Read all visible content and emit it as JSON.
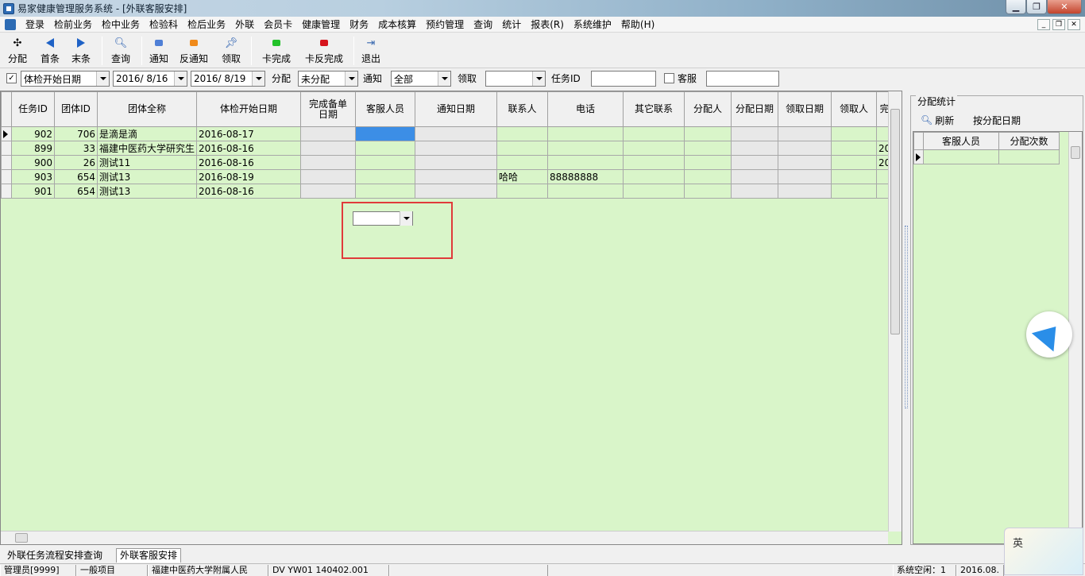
{
  "window": {
    "title": "易家健康管理服务系统 - [外联客服安排]",
    "controls": [
      "minimize",
      "restore",
      "close"
    ]
  },
  "menu": [
    "登录",
    "检前业务",
    "检中业务",
    "检验科",
    "检后业务",
    "外联",
    "会员卡",
    "健康管理",
    "财务",
    "成本核算",
    "预约管理",
    "查询",
    "统计",
    "报表(R)",
    "系统维护",
    "帮助(H)"
  ],
  "toolbar": {
    "assign": "分配",
    "first": "首条",
    "last": "末条",
    "query": "查询",
    "notify": "通知",
    "unnotify": "反通知",
    "receive": "领取",
    "card_complete": "卡完成",
    "card_uncomplete": "卡反完成",
    "exit": "退出"
  },
  "filters": {
    "date_type": "体检开始日期",
    "date_from": "2016/ 8/16",
    "date_to": "2016/ 8/19",
    "assign_label": "分配",
    "assign_value": "未分配",
    "notify_label": "通知",
    "notify_value": "全部",
    "receive_label": "领取",
    "receive_value": "",
    "task_id_label": "任务ID",
    "task_id_value": "",
    "service_label": "客服",
    "service_value": ""
  },
  "grid": {
    "columns": [
      "任务ID",
      "团体ID",
      "团体全称",
      "体检开始日期",
      "完成备单日期",
      "客服人员",
      "通知日期",
      "联系人",
      "电话",
      "其它联系",
      "分配人",
      "分配日期",
      "领取日期",
      "领取人",
      "完"
    ],
    "rows": [
      {
        "task_id": "902",
        "group_id": "706",
        "name": "是滴是滴",
        "start": "2016-08-17",
        "contact": "",
        "phone": "",
        "extra": ""
      },
      {
        "task_id": "899",
        "group_id": "33",
        "name": "福建中医药大学研究生",
        "start": "2016-08-16",
        "contact": "",
        "phone": "",
        "extra": "20"
      },
      {
        "task_id": "900",
        "group_id": "26",
        "name": "测试11",
        "start": "2016-08-16",
        "contact": "",
        "phone": "",
        "extra": "20"
      },
      {
        "task_id": "903",
        "group_id": "654",
        "name": "测试13",
        "start": "2016-08-19",
        "contact": "哈哈",
        "phone": "88888888",
        "extra": ""
      },
      {
        "task_id": "901",
        "group_id": "654",
        "name": "测试13",
        "start": "2016-08-16",
        "contact": "",
        "phone": "",
        "extra": ""
      }
    ],
    "floating_combo_value": ""
  },
  "stats": {
    "title": "分配统计",
    "refresh": "刷新",
    "by_date": "按分配日期",
    "columns": [
      "客服人员",
      "分配次数"
    ]
  },
  "tabs": [
    "外联任务流程安排查询",
    "外联客服安排"
  ],
  "status": {
    "user": "管理员[9999]",
    "item": "一般项目",
    "org": "福建中医药大学附属人民",
    "version": "DV YW01 140402.001",
    "idle": "系统空闲：1",
    "date": "2016.08."
  },
  "ime": {
    "label": "英"
  },
  "colors": {
    "grid_bg": "#d9f5c9",
    "selection": "#3c8ee6",
    "highlight_box": "#e03a3a"
  }
}
